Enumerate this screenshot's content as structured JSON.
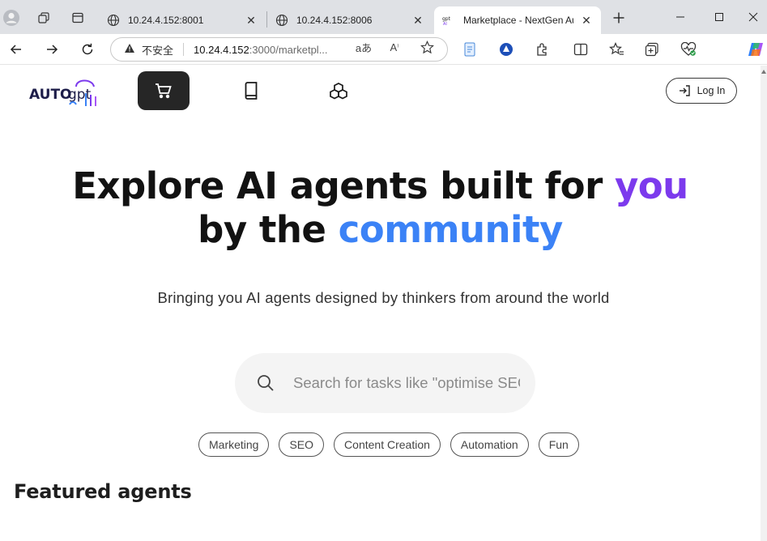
{
  "browser": {
    "tabs": [
      {
        "title": "10.24.4.152:8001",
        "active": false
      },
      {
        "title": "10.24.4.152:8006",
        "active": false
      },
      {
        "title": "Marketplace - NextGen AutoGPT",
        "active": true
      }
    ],
    "address": {
      "security_label": "不安全",
      "host": "10.24.4.152",
      "path": ":3000/marketpl..."
    },
    "toolbar_icons": [
      "read-aloud-icon",
      "text-size-icon",
      "favorite-star-icon",
      "document-icon",
      "vpn-icon",
      "extensions-icon",
      "split-screen-icon",
      "favorites-icon",
      "collections-icon",
      "browser-essentials-icon",
      "copilot-icon"
    ]
  },
  "header": {
    "logo_text": "AUTOgpt",
    "nav_items": [
      {
        "name": "marketplace",
        "icon": "cart-icon",
        "active": true
      },
      {
        "name": "library",
        "icon": "book-icon",
        "active": false
      },
      {
        "name": "build",
        "icon": "blocks-icon",
        "active": false
      }
    ],
    "login_label": "Log In"
  },
  "hero": {
    "line1_prefix": "Explore AI agents built for ",
    "line1_highlight": "you",
    "line2_prefix": "by the ",
    "line2_highlight": "community",
    "subtitle": "Bringing you AI agents designed by thinkers from around the world"
  },
  "search": {
    "placeholder": "Search for tasks like \"optimise SEO\"",
    "value": ""
  },
  "chips": [
    "Marketing",
    "SEO",
    "Content Creation",
    "Automation",
    "Fun"
  ],
  "featured": {
    "heading": "Featured agents"
  },
  "colors": {
    "accent_purple": "#7c3aed",
    "accent_blue": "#3b82f6",
    "active_nav_bg": "#262626"
  }
}
